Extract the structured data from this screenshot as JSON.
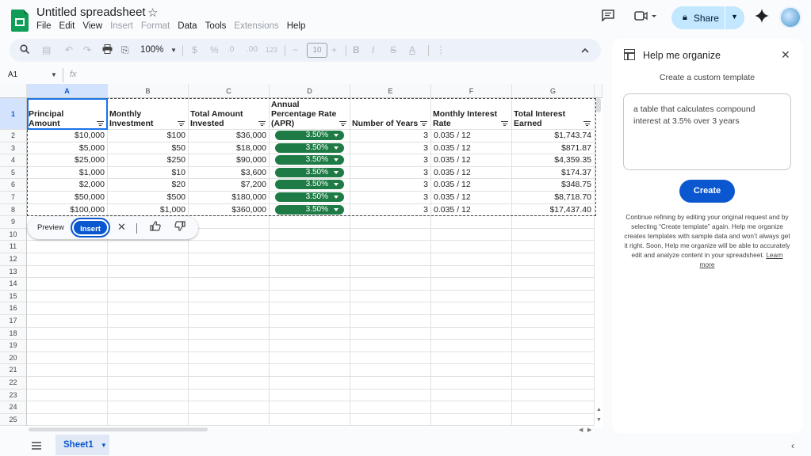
{
  "app": {
    "title": "Untitled spreadsheet",
    "menu": [
      "File",
      "Edit",
      "View",
      "Insert",
      "Format",
      "Data",
      "Tools",
      "Extensions",
      "Help"
    ],
    "menu_dim": [
      false,
      false,
      false,
      true,
      true,
      false,
      false,
      true,
      false
    ],
    "share_label": "Share"
  },
  "toolbar": {
    "zoom": "100%",
    "currency": "$",
    "percent": "%",
    "dec_decrease": ".0",
    "dec_increase": ".00",
    "format_123": "123",
    "font_size": "10",
    "bold": "B",
    "italic": "I",
    "strike": "S",
    "text_color": "A",
    "minus": "−",
    "plus": "+"
  },
  "formula_bar": {
    "cell_ref": "A1",
    "fx": "fx"
  },
  "grid": {
    "columns": [
      "A",
      "B",
      "C",
      "D",
      "E",
      "F",
      "G"
    ],
    "rows": [
      "1",
      "2",
      "3",
      "4",
      "5",
      "6",
      "7",
      "8",
      "9",
      "10",
      "11",
      "12",
      "13",
      "14",
      "15",
      "16",
      "17",
      "18",
      "19",
      "20",
      "21",
      "22",
      "23",
      "24",
      "25"
    ],
    "headers": [
      "Principal Amount",
      "Monthly Investment",
      "Total Amount Invested",
      "Annual Percentage Rate (APR)",
      "Number of Years",
      "Monthly Interest Rate",
      "Total Interest Earned"
    ],
    "data": [
      [
        "$10,000",
        "$100",
        "$36,000",
        "3.50%",
        "3",
        "0.035 / 12",
        "$1,743.74"
      ],
      [
        "$5,000",
        "$50",
        "$18,000",
        "3.50%",
        "3",
        "0.035 / 12",
        "$871.87"
      ],
      [
        "$25,000",
        "$250",
        "$90,000",
        "3.50%",
        "3",
        "0.035 / 12",
        "$4,359.35"
      ],
      [
        "$1,000",
        "$10",
        "$3,600",
        "3.50%",
        "3",
        "0.035 / 12",
        "$174.37"
      ],
      [
        "$2,000",
        "$20",
        "$7,200",
        "3.50%",
        "3",
        "0.035 / 12",
        "$348.75"
      ],
      [
        "$50,000",
        "$500",
        "$180,000",
        "3.50%",
        "3",
        "0.035 / 12",
        "$8,718.70"
      ],
      [
        "$100,000",
        "$1,000",
        "$360,000",
        "3.50%",
        "3",
        "0.035 / 12",
        "$17,437.40"
      ]
    ]
  },
  "preview_bar": {
    "preview_label": "Preview",
    "insert_label": "Insert"
  },
  "sheets": {
    "active": "Sheet1"
  },
  "panel": {
    "title": "Help me organize",
    "subtitle": "Create a custom template",
    "prompt_text": "a table that calculates compound interest at 3.5% over 3 years",
    "create_label": "Create",
    "note": "Continue refining by editing your original request and by selecting “Create template” again. Help me organize creates templates with sample data and won’t always get it right. Soon, Help me organize will be able to accurately edit and analyze content in your spreadsheet.",
    "learn_more": "Learn more"
  },
  "colors": {
    "accent": "#0b57d0",
    "chip_green": "#1e7b45",
    "share_bg": "#c2e7ff",
    "selection": "#1a73e8"
  }
}
